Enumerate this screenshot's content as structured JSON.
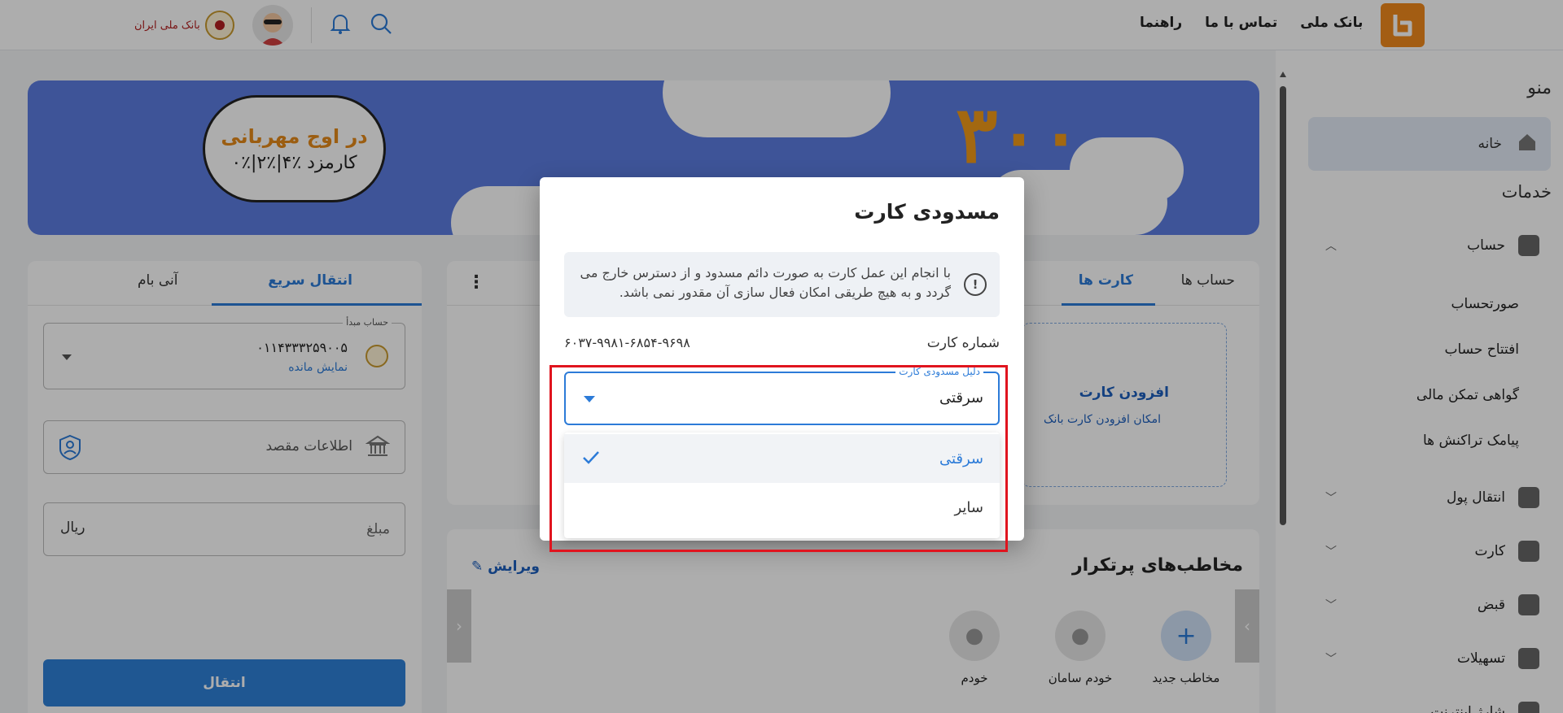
{
  "header": {
    "nav": [
      "بانک ملی",
      "تماس با ما",
      "راهنما"
    ],
    "bank_logo_text": "بانک ملی ایران",
    "icons": [
      "logo-icon",
      "search-icon",
      "bell-icon",
      "avatar",
      "bank-emblem-icon"
    ]
  },
  "sidebar": {
    "menu_title": "منو",
    "home": "خانه",
    "services_title": "خدمات",
    "account": "حساب",
    "account_sub": [
      "صورتحساب",
      "افتتاح حساب",
      "گواهی تمکن مالی",
      "پیامک تراکنش ها"
    ],
    "items": [
      "انتقال پول",
      "کارت",
      "قبض",
      "تسهیلات",
      "شارژ اینترنت"
    ]
  },
  "banner": {
    "headline": "در اوج مهربانی",
    "fee": "کارمزد ٪۴|٪۲|٪۰",
    "number": "۳۰۰"
  },
  "card_panel": {
    "tabs": [
      "حساب ها",
      "کارت ها"
    ],
    "active_tab": "کارت ها",
    "add_card": "افزودن کارت",
    "add_card_desc": "امکان افزودن کارت بانک"
  },
  "contacts": {
    "title": "مخاطب‌های پرتکرار",
    "edit": "ویرایش",
    "items": [
      "مخاطب جدید",
      "خودم سامان",
      "خودم"
    ]
  },
  "transfer": {
    "tabs": [
      "انتقال سریع",
      "آنی بام"
    ],
    "source_label": "حساب مبدأ",
    "account_number": "۰۱۱۴۳۳۳۲۵۹۰۰۵",
    "show_balance": "نمایش مانده",
    "destination_placeholder": "اطلاعات مقصد",
    "amount_placeholder": "مبلغ",
    "currency": "ریال",
    "button": "انتقال"
  },
  "modal": {
    "title": "مسدودی کارت",
    "warning": "با انجام این عمل کارت به صورت دائم مسدود و از دسترس خارج می گردد و به هیچ طریقی امکان فعال سازی آن مقدور نمی باشد.",
    "card_number_label": "شماره کارت",
    "card_number": "۶۰۳۷-۹۹۸۱-۶۸۵۴-۹۶۹۸",
    "reason_label": "دلیل مسدودی کارت",
    "reason_value": "سرقتی",
    "options": [
      "سرقتی",
      "سایر"
    ]
  },
  "colors": {
    "primary": "#2c7bd8",
    "brand_orange": "#f08a1c",
    "highlight_red": "#e0141e"
  }
}
